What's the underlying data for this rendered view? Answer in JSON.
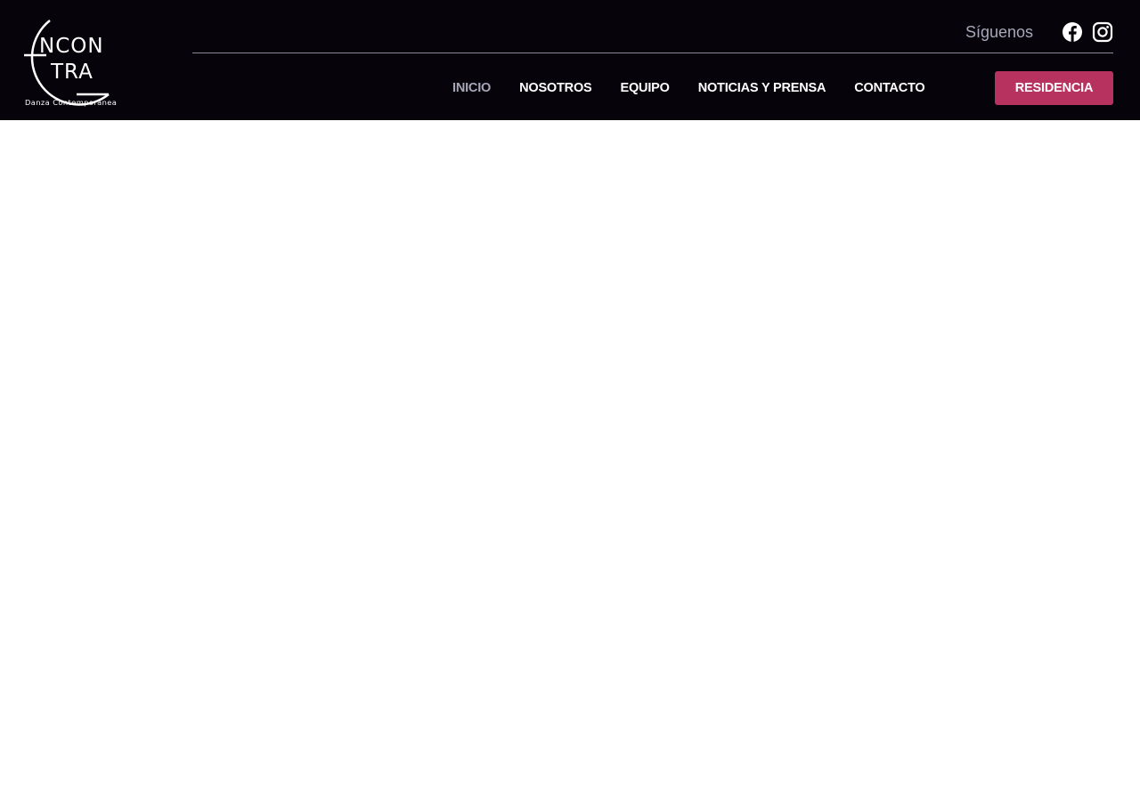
{
  "brand": {
    "logo_line1": "NCON",
    "logo_line2": "TRA",
    "logo_subtitle": "Danza Contemporánea"
  },
  "header": {
    "follow_label": "Síguenos",
    "social": [
      {
        "name": "facebook-icon"
      },
      {
        "name": "instagram-icon"
      }
    ]
  },
  "nav": {
    "items": [
      {
        "label": "INICIO",
        "active": true
      },
      {
        "label": "NOSOTROS",
        "active": false
      },
      {
        "label": "EQUIPO",
        "active": false
      },
      {
        "label": "NOTICIAS Y PRENSA",
        "active": false
      },
      {
        "label": "CONTACTO",
        "active": false
      }
    ],
    "cta_label": "RESIDENCIA"
  },
  "colors": {
    "header_bg": "#07030a",
    "accent": "#b8325f",
    "muted_text": "#a6a8b9"
  }
}
